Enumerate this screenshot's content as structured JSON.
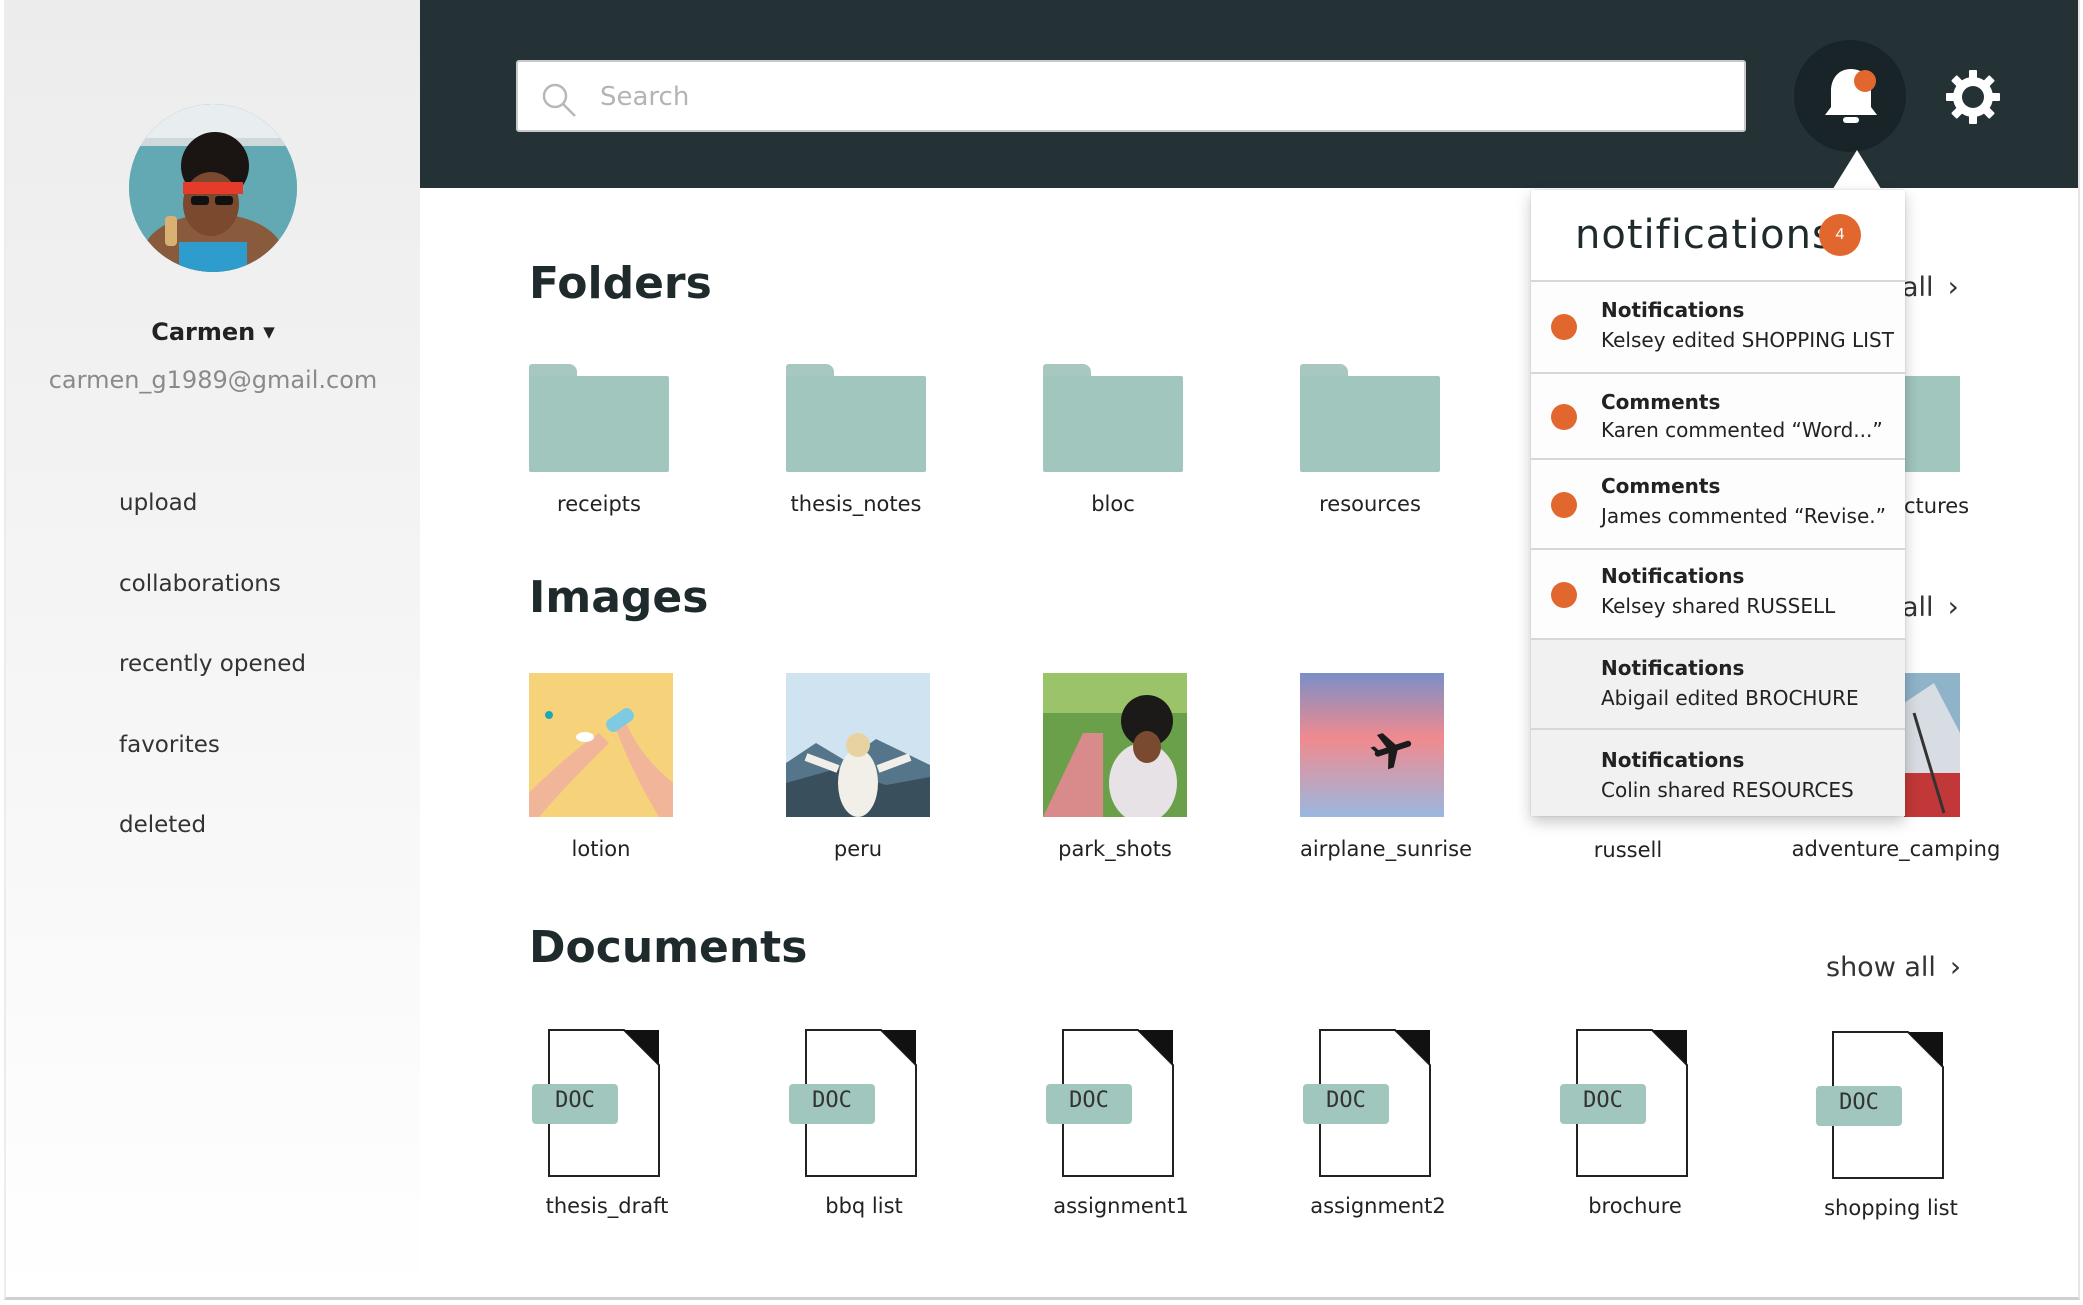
{
  "user": {
    "name": "Carmen",
    "email": "carmen_g1989@gmail.com"
  },
  "nav": {
    "items": [
      {
        "label": "upload"
      },
      {
        "label": "collaborations"
      },
      {
        "label": "recently opened"
      },
      {
        "label": "favorites"
      },
      {
        "label": "deleted"
      }
    ]
  },
  "search": {
    "placeholder": "Search",
    "value": ""
  },
  "notifications": {
    "header": "notifications",
    "count": "4",
    "items": [
      {
        "title": "Notifications",
        "text": "Kelsey edited SHOPPING LIST",
        "unread": true
      },
      {
        "title": "Comments",
        "text": "Karen commented “Word...”",
        "unread": true
      },
      {
        "title": "Comments",
        "text": "James commented “Revise.”",
        "unread": true
      },
      {
        "title": "Notifications",
        "text": "Kelsey shared RUSSELL",
        "unread": true
      },
      {
        "title": "Notifications",
        "text": "Abigail edited BROCHURE",
        "unread": false
      },
      {
        "title": "Notifications",
        "text": "Colin shared RESOURCES",
        "unread": false
      }
    ]
  },
  "sections": {
    "folders": {
      "title": "Folders",
      "show_all_partial": "all",
      "items": [
        "receipts",
        "thesis_notes",
        "bloc",
        "resources",
        "ctures"
      ]
    },
    "images": {
      "title": "Images",
      "show_all_partial": "all",
      "items": [
        "lotion",
        "peru",
        "park_shots",
        "airplane_sunrise",
        "russell",
        "adventure_camping"
      ]
    },
    "documents": {
      "title": "Documents",
      "show_all": "show all",
      "badge": "DOC",
      "items": [
        "thesis_draft",
        "bbq list",
        "assignment1",
        "assignment2",
        "brochure",
        "shopping list"
      ]
    }
  },
  "colors": {
    "topbar": "#243236",
    "accent": "#e2672f",
    "folder": "#a0c6bd"
  },
  "icons": {
    "search": "search-icon",
    "bell": "bell-icon",
    "gear": "gear-icon",
    "chevron": "chevron-right-icon",
    "caret": "caret-down-icon"
  }
}
